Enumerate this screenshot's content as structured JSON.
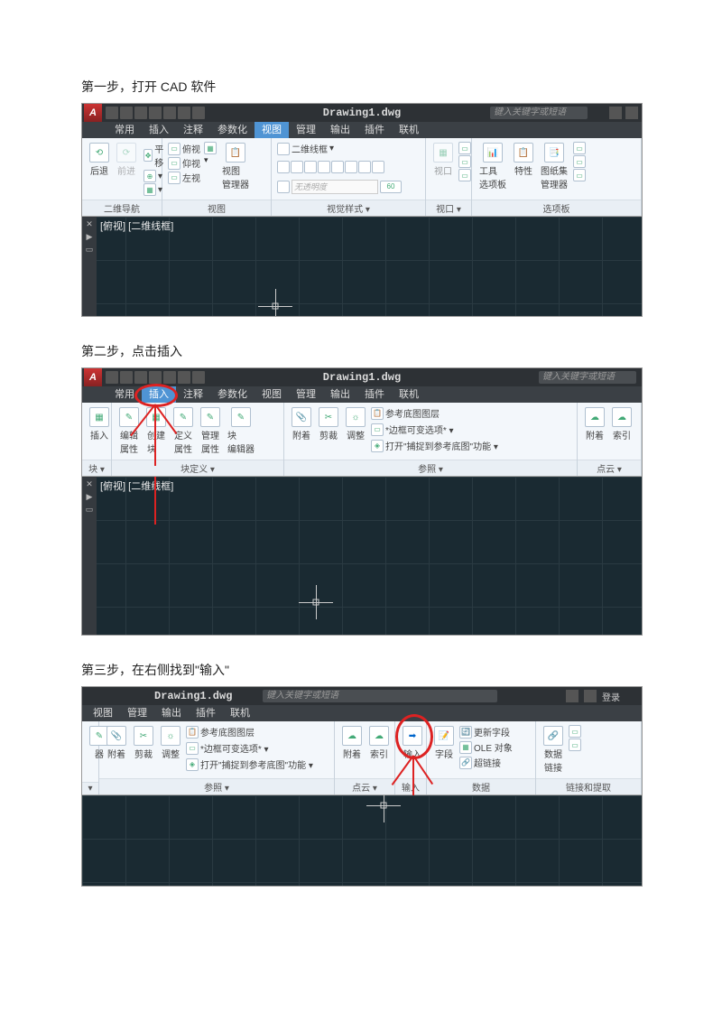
{
  "doc": {
    "step1_text": "第一步，打开 CAD 软件",
    "step2_text": "第二步，点击插入",
    "step3_text": "第三步，在右侧找到\"输入\""
  },
  "cad": {
    "title": "Drawing1.dwg",
    "search_placeholder": "键入关键字或短语",
    "login": "登录",
    "viewport_label": "[俯视] [二维线框]",
    "tabs": {
      "常用": "常用",
      "插入": "插入",
      "注释": "注释",
      "参数化": "参数化",
      "视图": "视图",
      "管理": "管理",
      "输出": "输出",
      "插件": "插件",
      "联机": "联机"
    },
    "panels": {
      "二维导航": "二维导航",
      "视图": "视图",
      "视觉样式": "视觉样式",
      "视口": "视口",
      "选项板": "选项板",
      "块": "块",
      "块定义": "块定义",
      "参照": "参照",
      "点云": "点云",
      "输入": "输入",
      "数据": "数据",
      "链接和提取": "链接和提取"
    },
    "btns": {
      "后退": "后退",
      "前进": "前进",
      "平移": "平移",
      "俯视": "俯视",
      "仰视": "仰视",
      "左视": "左视",
      "视图管理器": "视图\n管理器",
      "二维线框": "二维线框",
      "切换回": "无透明度",
      "60": "60",
      "视口": "视口",
      "工具选项板": "工具\n选项板",
      "特性": "特性",
      "图纸集管理器": "图纸集\n管理器",
      "插入": "插入",
      "编辑属性": "编辑\n属性",
      "创建块": "创建\n块",
      "定义属性": "定义\n属性",
      "管理属性": "管理\n属性",
      "块编辑器": "块\n编辑器",
      "附着": "附着",
      "剪裁": "剪裁",
      "调整": "调整",
      "参考底图图层": "参考底图图层",
      "边框可变选项": "*边框可变选项* ▾",
      "打开捕捉到参考底图": "打开\"捕捉到参考底图\"功能 ▾",
      "索引": "索引",
      "输入": "输入",
      "字段": "字段",
      "更新字段": "更新字段",
      "OLE对象": "OLE 对象",
      "超链接": "超链接",
      "数据链接": "数据\n链接",
      "步器": "器"
    }
  }
}
